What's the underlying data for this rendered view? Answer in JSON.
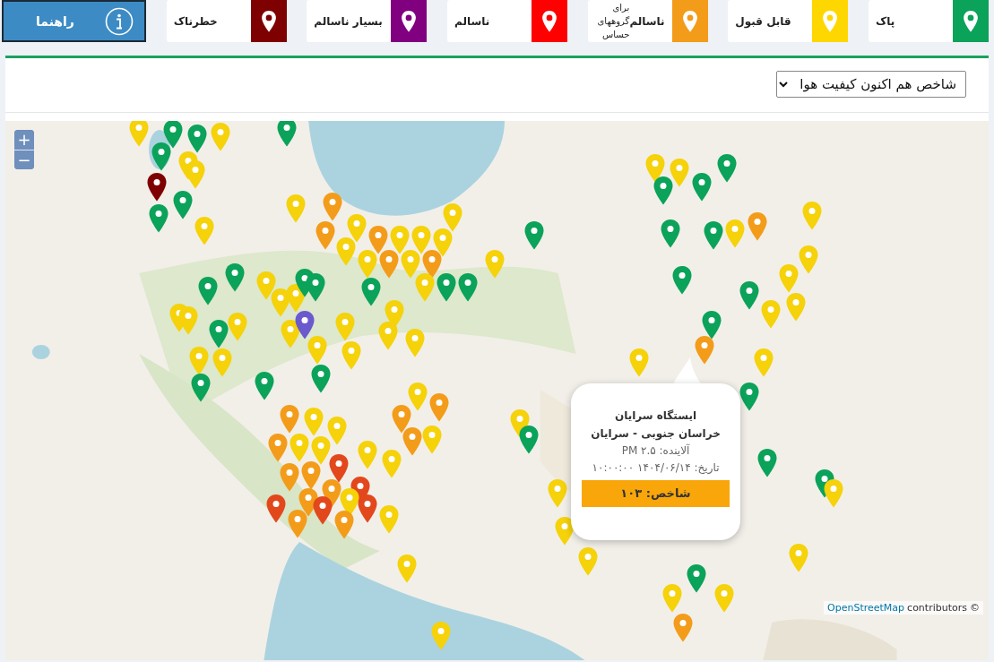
{
  "help_button": {
    "label": "راهنما"
  },
  "legend": [
    {
      "label": "پاک",
      "color": "#0ba25a"
    },
    {
      "label": "قابل قبول",
      "color": "#ffd700"
    },
    {
      "label": "**ناسالم** برای گروههای حساس",
      "color": "#f39c1a"
    },
    {
      "label": "ناسالم",
      "color": "#ff0000"
    },
    {
      "label": "بسیار ناسالم",
      "color": "#800080"
    },
    {
      "label": "خطرناک",
      "color": "#7e0000"
    }
  ],
  "index_select": {
    "value": "شاخص هم اکنون کیفیت هوا"
  },
  "map": {
    "zoom": [
      "+",
      "−"
    ],
    "markers": [
      {
        "color": "#f5d20a"
      },
      {
        "color": "#0ba25a"
      },
      {
        "color": "#0ba25a"
      },
      {
        "color": "#f5d20a"
      },
      {
        "color": "#0ba25a"
      },
      {
        "color": "#0ba25a"
      },
      {
        "color": "#f5d20a"
      },
      {
        "color": "#f5d20a"
      },
      {
        "color": "#7e0000"
      },
      {
        "color": "#0ba25a"
      },
      {
        "color": "#0ba25a"
      },
      {
        "color": "#f5d20a"
      },
      {
        "color": "#f5d20a"
      },
      {
        "color": "#f39c1a"
      },
      {
        "color": "#f39c1a"
      },
      {
        "color": "#f5d20a"
      },
      {
        "color": "#f5d20a"
      },
      {
        "color": "#f5d20a"
      },
      {
        "color": "#f39c1a"
      },
      {
        "color": "#f39c1a"
      },
      {
        "color": "#f5d20a"
      },
      {
        "color": "#f5d20a"
      },
      {
        "color": "#f5d20a"
      },
      {
        "color": "#f39c1a"
      },
      {
        "color": "#f5d20a"
      },
      {
        "color": "#f5d20a"
      },
      {
        "color": "#0ba25a"
      },
      {
        "color": "#0ba25a"
      },
      {
        "color": "#f5d20a"
      },
      {
        "color": "#f5d20a"
      },
      {
        "color": "#0ba25a"
      },
      {
        "color": "#0ba25a"
      },
      {
        "color": "#0ba25a"
      },
      {
        "color": "#f5d20a"
      },
      {
        "color": "#f5d20a"
      },
      {
        "color": "#f5d20a"
      },
      {
        "color": "#0ba25a"
      },
      {
        "color": "#0ba25a"
      },
      {
        "color": "#0ba25a"
      },
      {
        "color": "#f5d20a"
      },
      {
        "color": "#f5d20a"
      },
      {
        "color": "#f5d20a"
      },
      {
        "color": "#f5d20a"
      },
      {
        "color": "#6a5acd"
      },
      {
        "color": "#f5d20a"
      },
      {
        "color": "#f5d20a"
      },
      {
        "color": "#f5d20a"
      },
      {
        "color": "#f5d20a"
      },
      {
        "color": "#f5d20a"
      },
      {
        "color": "#f5d20a"
      },
      {
        "color": "#0ba25a"
      },
      {
        "color": "#f5d20a"
      },
      {
        "color": "#f5d20a"
      },
      {
        "color": "#0ba25a"
      },
      {
        "color": "#0ba25a"
      },
      {
        "color": "#0ba25a"
      },
      {
        "color": "#f5d20a"
      },
      {
        "color": "#f39c1a"
      },
      {
        "color": "#f39c1a"
      },
      {
        "color": "#f39c1a"
      },
      {
        "color": "#f39c1a"
      },
      {
        "color": "#f5d20a"
      },
      {
        "color": "#f5d20a"
      },
      {
        "color": "#f5d20a"
      },
      {
        "color": "#f5d20a"
      },
      {
        "color": "#f39c1a"
      },
      {
        "color": "#f5d20a"
      },
      {
        "color": "#f5d20a"
      },
      {
        "color": "#f5d20a"
      },
      {
        "color": "#f39c1a"
      },
      {
        "color": "#f39c1a"
      },
      {
        "color": "#e2481c"
      },
      {
        "color": "#f39c1a"
      },
      {
        "color": "#e2481c"
      },
      {
        "color": "#f5d20a"
      },
      {
        "color": "#e2481c"
      },
      {
        "color": "#f39c1a"
      },
      {
        "color": "#e2481c"
      },
      {
        "color": "#e2481c"
      },
      {
        "color": "#f39c1a"
      },
      {
        "color": "#f39c1a"
      },
      {
        "color": "#f5d20a"
      },
      {
        "color": "#f5d20a"
      },
      {
        "color": "#f5d20a"
      },
      {
        "color": "#f5d20a"
      },
      {
        "color": "#0ba25a"
      },
      {
        "color": "#f5d20a"
      },
      {
        "color": "#f5d20a"
      },
      {
        "color": "#f5d20a"
      },
      {
        "color": "#f5d20a"
      },
      {
        "color": "#f5d20a"
      },
      {
        "color": "#0ba25a"
      },
      {
        "color": "#0ba25a"
      },
      {
        "color": "#0ba25a"
      },
      {
        "color": "#0ba25a"
      },
      {
        "color": "#0ba25a"
      },
      {
        "color": "#f5d20a"
      },
      {
        "color": "#f39c1a"
      },
      {
        "color": "#f5d20a"
      },
      {
        "color": "#f5d20a"
      },
      {
        "color": "#f5d20a"
      },
      {
        "color": "#0ba25a"
      },
      {
        "color": "#0ba25a"
      },
      {
        "color": "#f5d20a"
      },
      {
        "color": "#f5d20a"
      },
      {
        "color": "#0ba25a"
      },
      {
        "color": "#f39c1a"
      },
      {
        "color": "#f5d20a"
      },
      {
        "color": "#f5d20a"
      },
      {
        "color": "#0ba25a"
      },
      {
        "color": "#0ba25a"
      },
      {
        "color": "#0ba25a"
      },
      {
        "color": "#f5d20a"
      },
      {
        "color": "#f5d20a"
      },
      {
        "color": "#0ba25a"
      },
      {
        "color": "#f5d20a"
      },
      {
        "color": "#f5d20a"
      },
      {
        "color": "#f39c1a"
      }
    ],
    "popup": {
      "title": "ایستگاه سرایان",
      "region": "خراسان جنوبی - سرایان",
      "pollutant": "آلاینده: PM ۲.۵",
      "date": "تاریخ: ۱۴۰۴/۰۶/۱۴ ۱۰:۰۰:۰۰",
      "index": {
        "text": "شاخص: ۱۰۳",
        "color": "#f9a60b"
      }
    },
    "attribution": {
      "link": "OpenStreetMap",
      "text": "contributors",
      "symbol": "©"
    }
  }
}
